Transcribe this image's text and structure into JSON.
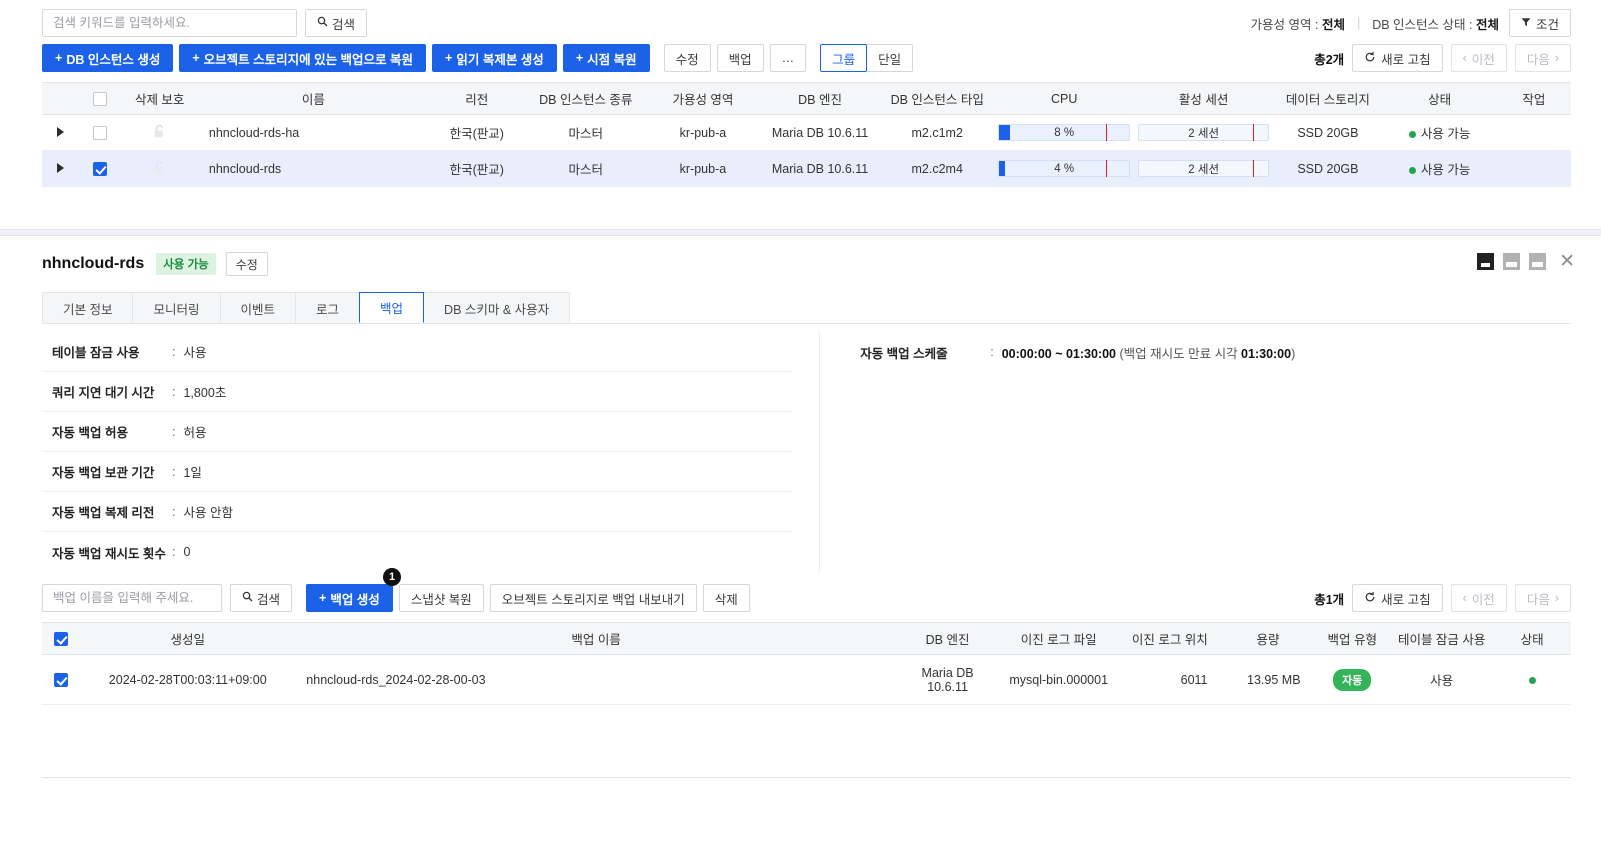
{
  "topbar": {
    "search_placeholder": "검색 키워드를 입력하세요.",
    "search_button": "검색",
    "search_icon": "search-icon",
    "filter_az_label": "가용성 영역 :",
    "filter_az_value": "전체",
    "filter_status_label": "DB 인스턴스 상태 :",
    "filter_status_value": "전체",
    "condition_button": "조건",
    "condition_icon": "funnel-icon"
  },
  "actionbar": {
    "create_instance": "DB 인스턴스 생성",
    "restore_object_storage": "오브젝트 스토리지에 있는 백업으로 복원",
    "create_read_replica": "읽기 복제본 생성",
    "point_in_time_restore": "시점 복원",
    "plus": "+",
    "modify": "수정",
    "backup": "백업",
    "more": "…",
    "group": "그룹",
    "single": "단일",
    "selected_segment": "그룹",
    "total": "총2개",
    "refresh": "새로 고침",
    "refresh_icon": "refresh-icon",
    "prev": "이전",
    "next": "다음"
  },
  "instance_table": {
    "columns": [
      "삭제 보호",
      "이름",
      "리전",
      "DB 인스턴스 종류",
      "가용성 영역",
      "DB 엔진",
      "DB 인스턴스 타입",
      "CPU",
      "활성 세션",
      "데이터 스토리지",
      "상태",
      "작업"
    ],
    "rows": [
      {
        "checked": false,
        "delete_protection": "unlocked-icon",
        "name": "nhncloud-rds-ha",
        "region": "한국(판교)",
        "instance_kind": "마스터",
        "availability_zone": "kr-pub-a",
        "db_engine": "Maria DB 10.6.11",
        "instance_type": "m2.c1m2",
        "cpu_percent": 8,
        "cpu_label": "8 %",
        "sessions_label": "2 세션",
        "sessions_percent": 80,
        "data_storage": "SSD 20GB",
        "status": "사용 가능",
        "task": ""
      },
      {
        "checked": true,
        "delete_protection": "unlocked-icon",
        "name": "nhncloud-rds",
        "region": "한국(판교)",
        "instance_kind": "마스터",
        "availability_zone": "kr-pub-a",
        "db_engine": "Maria DB 10.6.11",
        "instance_type": "m2.c2m4",
        "cpu_percent": 4,
        "cpu_label": "4 %",
        "sessions_label": "2 세션",
        "sessions_percent": 80,
        "data_storage": "SSD 20GB",
        "status": "사용 가능",
        "task": ""
      }
    ]
  },
  "detail_panel": {
    "title": "nhncloud-rds",
    "status_badge": "사용 가능",
    "edit_button": "수정",
    "window_controls": [
      "panel-full-icon",
      "panel-half-icon",
      "panel-min-icon"
    ],
    "close_icon": "close-icon",
    "tabs": [
      {
        "label": "기본 정보",
        "active": false
      },
      {
        "label": "모니터링",
        "active": false
      },
      {
        "label": "이벤트",
        "active": false
      },
      {
        "label": "로그",
        "active": false
      },
      {
        "label": "백업",
        "active": true
      },
      {
        "label": "DB 스키마 & 사용자",
        "active": false
      }
    ],
    "left_info": [
      {
        "label": "테이블 잠금 사용",
        "value": "사용"
      },
      {
        "label": "쿼리 지연 대기 시간",
        "value": "1,800초"
      },
      {
        "label": "자동 백업 허용",
        "value": "허용"
      },
      {
        "label": "자동 백업 보관 기간",
        "value": "1일"
      },
      {
        "label": "자동 백업 복제 리전",
        "value": "사용 안함"
      },
      {
        "label": "자동 백업 재시도 횟수",
        "value": "0"
      }
    ],
    "right_info": [
      {
        "label": "자동 백업 스케줄",
        "value_bold_1": "00:00:00 ~ 01:30:00",
        "value_mid": " (백업 재시도 만료 시각 ",
        "value_bold_2": "01:30:00",
        "value_end": ")"
      }
    ]
  },
  "backup_toolbar": {
    "search_placeholder": "백업 이름을 입력해 주세요.",
    "search_button": "검색",
    "search_icon": "search-icon",
    "create_backup": "백업 생성",
    "plus": "+",
    "restore_snapshot": "스냅샷 복원",
    "export_object_storage": "오브젝트 스토리지로 백업 내보내기",
    "delete": "삭제",
    "marker_number": "1",
    "total": "총1개",
    "refresh": "새로 고침",
    "refresh_icon": "refresh-icon",
    "prev": "이전",
    "next": "다음"
  },
  "backup_table": {
    "header_checked": true,
    "columns": [
      "생성일",
      "백업 이름",
      "DB 엔진",
      "이진 로그 파일",
      "이진 로그 위치",
      "용량",
      "백업 유형",
      "테이블 잠금 사용",
      "상태"
    ],
    "rows": [
      {
        "checked": true,
        "created_at": "2024-02-28T00:03:11+09:00",
        "backup_name": "nhncloud-rds_2024-02-28-00-03",
        "db_engine": "Maria DB 10.6.11",
        "binlog_file": "mysql-bin.000001",
        "binlog_position": "6011",
        "size": "13.95 MB",
        "backup_type": "자동",
        "table_lock": "사용",
        "status": "ok-dot"
      }
    ]
  },
  "colors": {
    "primary": "#1c62e8",
    "green": "#21a452",
    "badge_green_bg": "#ddf2e1",
    "badge_green_text": "#1a8c3e",
    "auto_badge": "#35b35a",
    "red_marker": "#e02020",
    "selected_row": "#e8eefc"
  }
}
